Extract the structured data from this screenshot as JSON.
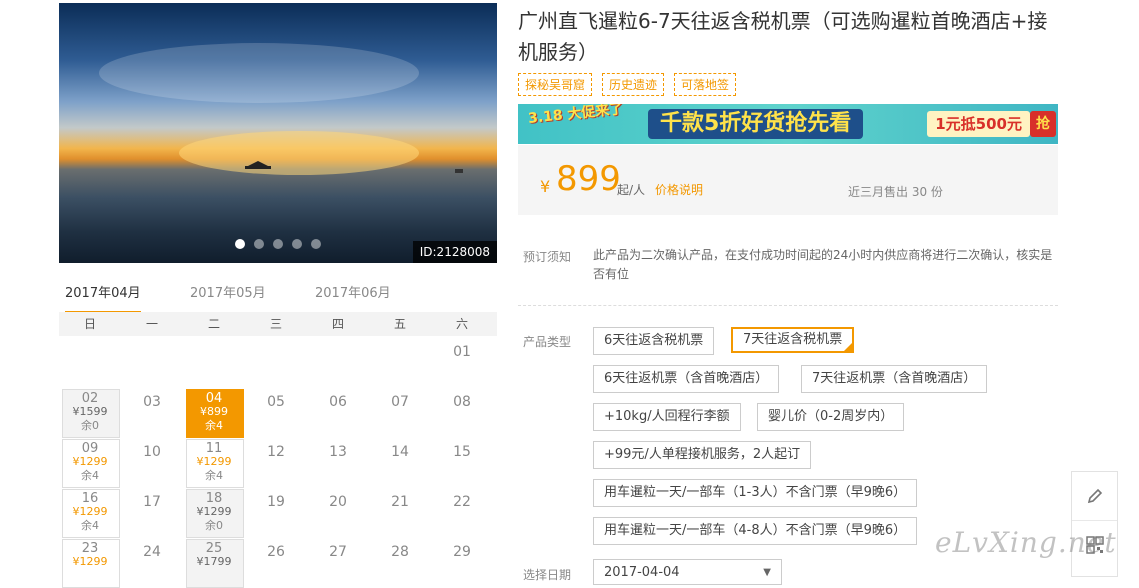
{
  "gallery": {
    "image_id": "ID:2128008",
    "dots": 5,
    "active_dot": 0
  },
  "months": [
    "2017年04月",
    "2017年05月",
    "2017年06月"
  ],
  "weekdays": [
    "日",
    "一",
    "二",
    "三",
    "四",
    "五",
    "六"
  ],
  "calendar": [
    [
      {
        "d": ""
      },
      {
        "d": ""
      },
      {
        "d": ""
      },
      {
        "d": ""
      },
      {
        "d": ""
      },
      {
        "d": ""
      },
      {
        "d": "01"
      }
    ],
    [
      {
        "d": "02",
        "p": "¥1599",
        "s": "余0",
        "st": "sold"
      },
      {
        "d": "03"
      },
      {
        "d": "04",
        "p": "¥899",
        "s": "余4",
        "st": "sel"
      },
      {
        "d": "05"
      },
      {
        "d": "06"
      },
      {
        "d": "07"
      },
      {
        "d": "08"
      }
    ],
    [
      {
        "d": "09",
        "p": "¥1299",
        "s": "余4",
        "st": "avail"
      },
      {
        "d": "10"
      },
      {
        "d": "11",
        "p": "¥1299",
        "s": "余4",
        "st": "avail"
      },
      {
        "d": "12"
      },
      {
        "d": "13"
      },
      {
        "d": "14"
      },
      {
        "d": "15"
      }
    ],
    [
      {
        "d": "16",
        "p": "¥1299",
        "s": "余4",
        "st": "avail"
      },
      {
        "d": "17"
      },
      {
        "d": "18",
        "p": "¥1299",
        "s": "余0",
        "st": "sold"
      },
      {
        "d": "19"
      },
      {
        "d": "20"
      },
      {
        "d": "21"
      },
      {
        "d": "22"
      }
    ],
    [
      {
        "d": "23",
        "p": "¥1299",
        "s": "",
        "st": "avail"
      },
      {
        "d": "24"
      },
      {
        "d": "25",
        "p": "¥1799",
        "s": "",
        "st": "sold"
      },
      {
        "d": "26"
      },
      {
        "d": "27"
      },
      {
        "d": "28"
      },
      {
        "d": "29"
      }
    ]
  ],
  "product": {
    "title": "广州直飞暹粒6-7天往返含税机票（可选购暹粒首晚酒店+接机服务）",
    "tags": [
      "探秘吴哥窟",
      "历史遗迹",
      "可落地签"
    ]
  },
  "banner": {
    "badge": "3.18 大促来了",
    "headline": "千款5折好货抢先看",
    "coupon": "1元抵500元",
    "grab": "抢"
  },
  "price": {
    "currency": "¥",
    "amount": "899",
    "unit": "起/人",
    "explain_link": "价格说明",
    "sales": "近三月售出 30 份"
  },
  "booking": {
    "notice_label": "预订须知",
    "notice": "此产品为二次确认产品，在支付成功时间起的24小时内供应商将进行二次确认，核实是否有位",
    "type_label": "产品类型",
    "options": [
      "6天往返含税机票",
      "7天往返含税机票",
      "6天往返机票（含首晚酒店）",
      "7天往返机票（含首晚酒店）",
      "+10kg/人回程行李额",
      "婴儿价（0-2周岁内）",
      "+99元/人单程接机服务，2人起订",
      "用车暹粒一天/一部车（1-3人）不含门票（早9晚6）",
      "用车暹粒一天/一部车（4-8人）不含门票（早9晚6）"
    ],
    "selected_option": 1,
    "date_label": "选择日期",
    "date_value": "2017-04-04"
  },
  "watermark": "eLvXing.net",
  "colors": {
    "accent": "#f39800"
  }
}
